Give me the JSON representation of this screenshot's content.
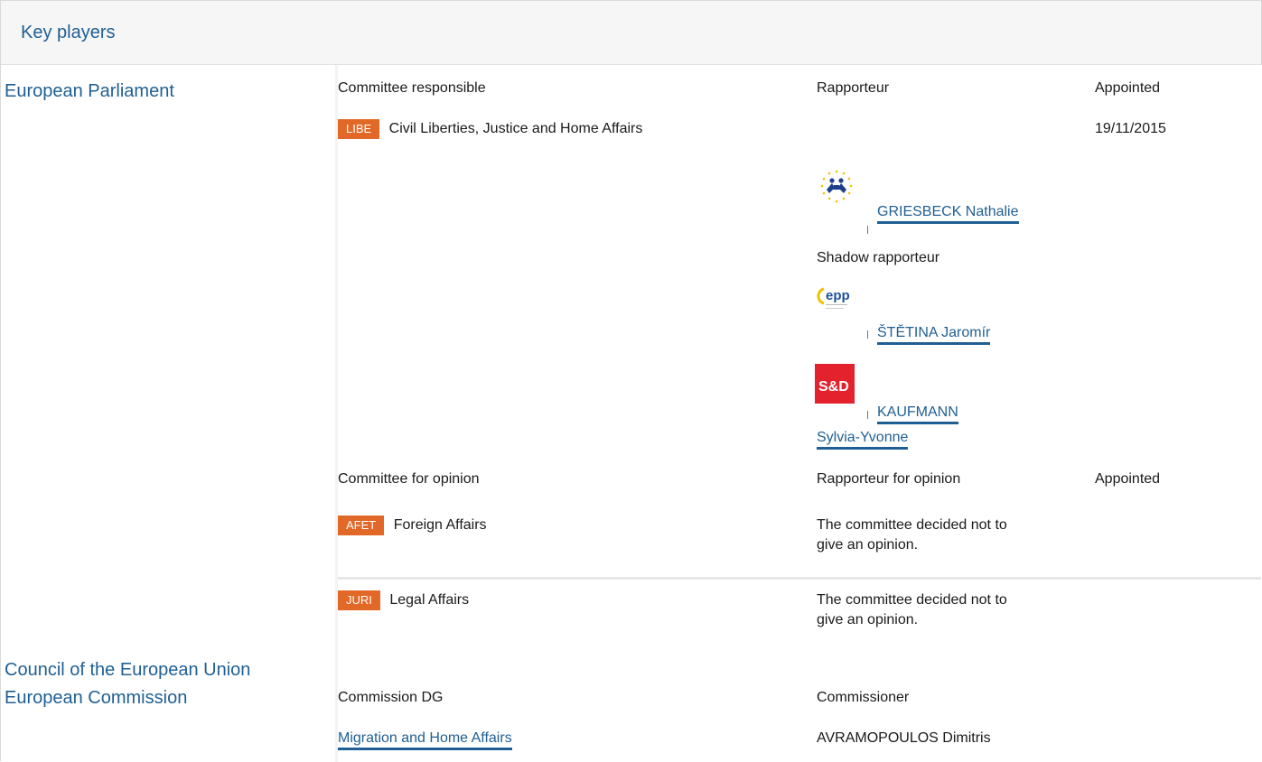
{
  "header": {
    "title": "Key players"
  },
  "sidebar": {
    "ep": "European Parliament",
    "council": "Council of the European Union",
    "commission": "European Commission"
  },
  "responsible": {
    "col_committee": "Committee responsible",
    "col_rapporteur": "Rapporteur",
    "col_appointed": "Appointed",
    "badge": "LIBE",
    "committee_name": "Civil Liberties, Justice and Home Affairs",
    "appointed_date": "19/11/2015",
    "rapporteur": {
      "name": "GRIESBECK Nathalie",
      "logo_icon": "alde-logo-icon"
    },
    "shadow_label": "Shadow rapporteur",
    "shadows": [
      {
        "name": "ŠTĚTINA Jaromír",
        "logo_icon": "epp-logo-icon",
        "logo_text": "epp"
      },
      {
        "name_line1": "KAUFMANN",
        "name_line2": "Sylvia-Yvonne",
        "logo_icon": "sd-logo-icon",
        "logo_text": "S&D"
      }
    ]
  },
  "opinion": {
    "col_committee": "Committee for opinion",
    "col_rapporteur": "Rapporteur for opinion",
    "col_appointed": "Appointed",
    "rows": [
      {
        "badge": "AFET",
        "name": "Foreign Affairs",
        "note_line1": "The committee decided not to",
        "note_line2": "give an opinion."
      },
      {
        "badge": "JURI",
        "name": "Legal Affairs",
        "note_line1": "The committee decided not to",
        "note_line2": "give an opinion."
      }
    ]
  },
  "commission": {
    "col_dg": "Commission DG",
    "col_commissioner": "Commissioner",
    "dg": "Migration and Home Affairs",
    "commissioner": "AVRAMOPOULOS Dimitris"
  },
  "colors": {
    "accent": "#1f5f93",
    "badge": "#e26828"
  }
}
